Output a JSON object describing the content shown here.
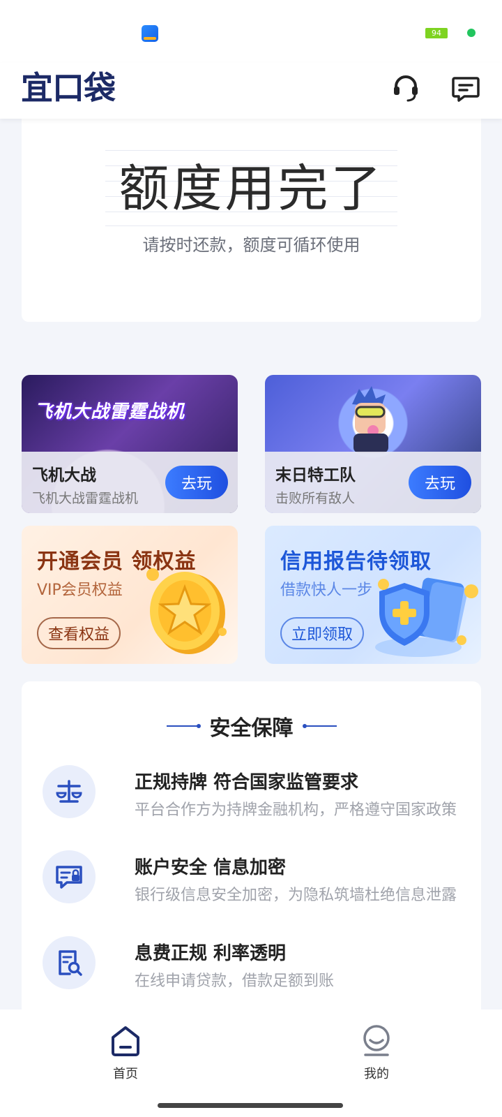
{
  "status_bar": {
    "battery": "94"
  },
  "header": {
    "logo": "宜口袋"
  },
  "quota": {
    "title": "额度用完了",
    "subtitle": "请按时还款，额度可循环使用"
  },
  "games": [
    {
      "banner": "飞机大战雷霆战机",
      "name": "飞机大战",
      "desc": "飞机大战雷霆战机",
      "button": "去玩"
    },
    {
      "name": "末日特工队",
      "desc": "击败所有敌人",
      "button": "去玩"
    }
  ],
  "promos": [
    {
      "title": "开通会员 领权益",
      "subtitle": "VIP会员权益",
      "button": "查看权益"
    },
    {
      "title": "信用报告待领取",
      "subtitle": "借款快人一步",
      "button": "立即领取"
    }
  ],
  "safety": {
    "title": "安全保障",
    "items": [
      {
        "icon": "scale-icon",
        "title": "正规持牌 符合国家监管要求",
        "desc": "平台合作方为持牌金融机构，严格遵守国家政策"
      },
      {
        "icon": "secure-message-icon",
        "title": "账户安全 信息加密",
        "desc": "银行级信息安全加密，为隐私筑墙杜绝信息泄露"
      },
      {
        "icon": "document-search-icon",
        "title": "息费正规  利率透明",
        "desc": "在线申请贷款，借款足额到账"
      }
    ]
  },
  "nav": [
    {
      "label": "首页",
      "icon": "home-icon"
    },
    {
      "label": "我的",
      "icon": "profile-icon"
    }
  ],
  "colors": {
    "brand": "#1c2a66",
    "primary_button": "#2f66f0",
    "background": "#f3f5fa",
    "online_dot": "#22c55e"
  }
}
